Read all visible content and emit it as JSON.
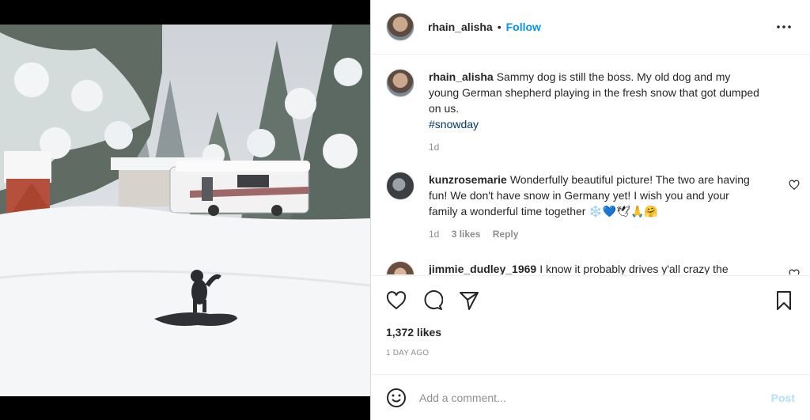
{
  "post": {
    "username": "rhain_alisha",
    "separator": "•",
    "follow_label": "Follow",
    "more_icon": "more-horizontal-icon",
    "caption": {
      "username": "rhain_alisha",
      "text": "Sammy dog is still the boss. My old dog and my young German shepherd playing in the fresh snow that got dumped on us.",
      "hashtag": "#snowday",
      "time": "1d"
    },
    "comments": [
      {
        "username": "kunzrosemarie",
        "text": "Wonderfully beautiful picture! The two are having fun! We don't have snow in Germany yet! I wish you and your family a wonderful time together ❄️💙🕊🙏🤗",
        "time": "1d",
        "likes": "3 likes",
        "reply_label": "Reply"
      },
      {
        "username": "jimmie_dudley_1969",
        "text": "I know it probably drives y'all crazy the"
      }
    ],
    "likes": "1,372 likes",
    "date": "1 DAY AGO",
    "comment_placeholder": "Add a comment...",
    "post_label": "Post"
  },
  "colors": {
    "accent": "#0095f6",
    "hashtag": "#00376b",
    "muted": "#8e8e8e",
    "post_disabled": "#b2dffc"
  }
}
